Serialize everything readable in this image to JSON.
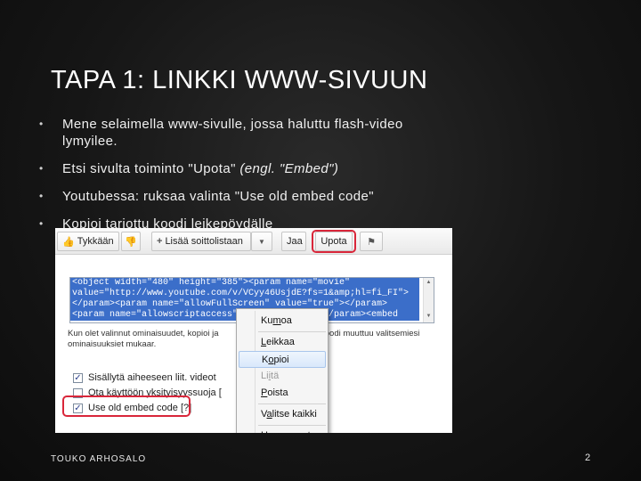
{
  "slide": {
    "title": "TAPA 1: LINKKI WWW-SIVUUN",
    "footer_author": "TOUKO ARHOSALO",
    "page_number": "2",
    "bullets": [
      {
        "text": "Mene selaimella www-sivulle, jossa haluttu flash-video lymyilee."
      },
      {
        "text": "Etsi sivulta toiminto \"Upota\" ",
        "italic": "(engl. \"Embed\")"
      },
      {
        "text": "Youtubessa: ruksaa valinta \"Use old embed code\""
      },
      {
        "text": "Kopioi tarjottu koodi leikepöydälle"
      }
    ]
  },
  "screenshot": {
    "toolbar": {
      "like_label": "Tykkään",
      "add_playlist_label": "Lisää soittolistaan",
      "share_label": "Jaa",
      "embed_label": "Upota"
    },
    "code_lines": [
      "<object width=\"480\" height=\"385\"><param name=\"movie\"",
      "value=\"http://www.youtube.com/v/VCyy46UsjdE?fs=1&amp;hl=fi_FI\">",
      "</param><param name=\"allowFullScreen\" value=\"true\"></param>",
      "<param name=\"allowscriptaccess\" value=\"always\"></param><embed"
    ],
    "info_text": "Kun olet valinnut ominaisuudet, kopioi ja",
    "info_text_line2": "ominaisuuksiet mukaar.",
    "info_tail": "koodi muuttuu valitsemiesi",
    "checkboxes": [
      {
        "label": "Sisällytä aiheeseen liit. videot",
        "checked": true
      },
      {
        "label": "Ota käyttöön yksityisyyssuoja [",
        "checked": false
      },
      {
        "label": "Use old embed code [?]",
        "checked": true
      }
    ],
    "context_menu": [
      {
        "label": "Kumoa",
        "mnemonic_index": 2
      },
      {
        "label": "Leikkaa",
        "mnemonic_index": 0
      },
      {
        "label": "Kopioi",
        "mnemonic_index": 1
      },
      {
        "label": "Liitä",
        "mnemonic_index": 2
      },
      {
        "label": "Poista",
        "mnemonic_index": 0
      },
      {
        "label": "Valitse kaikki",
        "mnemonic_index": 1
      },
      {
        "label": "Hae sanasta",
        "mnemonic_index": 0
      }
    ]
  }
}
